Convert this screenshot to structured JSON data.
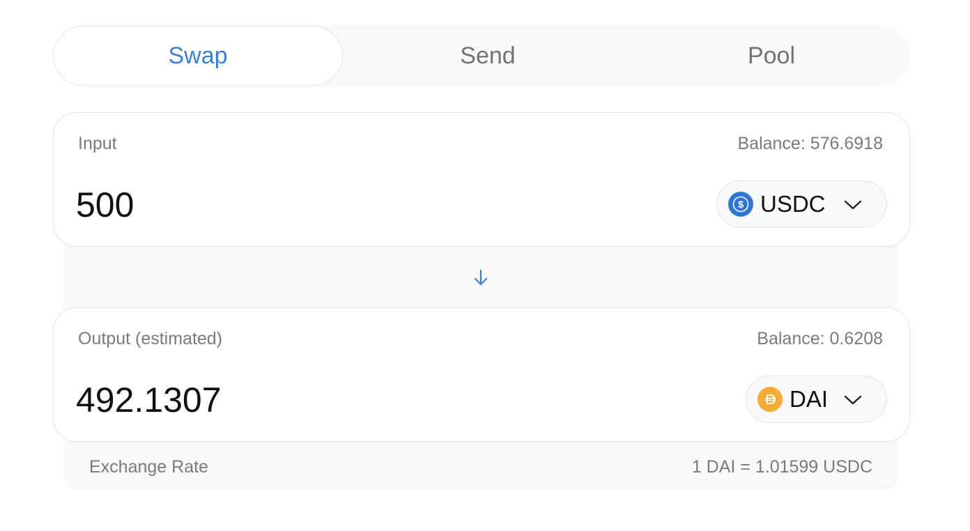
{
  "tabs": [
    {
      "label": "Swap",
      "active": true
    },
    {
      "label": "Send",
      "active": false
    },
    {
      "label": "Pool",
      "active": false
    }
  ],
  "input_panel": {
    "label": "Input",
    "balance": "Balance: 576.6918",
    "amount": "500",
    "token": "USDC",
    "token_icon": "usdc-coin-icon"
  },
  "output_panel": {
    "label": "Output (estimated)",
    "balance": "Balance: 0.6208",
    "amount": "492.1307",
    "token": "DAI",
    "token_icon": "dai-coin-icon"
  },
  "exchange_rate": {
    "label": "Exchange Rate",
    "value": "1 DAI = 1.01599 USDC"
  },
  "colors": {
    "accent": "#3d7fd6",
    "usdc": "#2f76d2",
    "dai": "#f5ac37",
    "muted_text": "#7a7a7a"
  }
}
